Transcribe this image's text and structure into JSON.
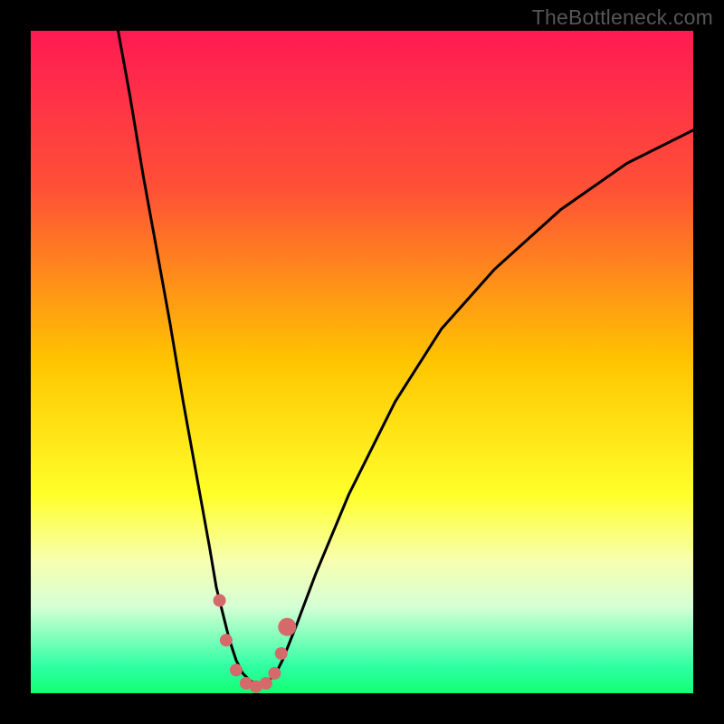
{
  "watermark": "TheBottleneck.com",
  "chart_data": {
    "type": "line",
    "title": "",
    "xlabel": "",
    "ylabel": "",
    "xlim": [
      0,
      100
    ],
    "ylim": [
      0,
      100
    ],
    "gradient_stops": [
      {
        "offset": 0,
        "color": "#ff1a53"
      },
      {
        "offset": 24,
        "color": "#ff5136"
      },
      {
        "offset": 50,
        "color": "#ffc500"
      },
      {
        "offset": 70,
        "color": "#ffff2a"
      },
      {
        "offset": 80,
        "color": "#f7ffb0"
      },
      {
        "offset": 87,
        "color": "#d5ffd5"
      },
      {
        "offset": 96,
        "color": "#2effa2"
      },
      {
        "offset": 100,
        "color": "#12ff74"
      }
    ],
    "series": [
      {
        "name": "bottleneck-curve",
        "x": [
          13,
          15,
          17,
          19,
          21,
          23,
          25,
          27,
          28,
          29,
          30,
          31,
          32,
          33,
          34.5,
          36,
          37,
          38,
          40,
          43,
          48,
          55,
          62,
          70,
          80,
          90,
          100
        ],
        "y": [
          101,
          90,
          78,
          67,
          56,
          44,
          33,
          22,
          16,
          12,
          8,
          5,
          3,
          2,
          1,
          2,
          3,
          5,
          10,
          18,
          30,
          44,
          55,
          64,
          73,
          80,
          85
        ]
      }
    ],
    "markers": {
      "name": "highlighted-points",
      "color": "#d46a6a",
      "radius_small": 7,
      "radius_large": 10,
      "points": [
        {
          "x": 28.5,
          "y": 14,
          "r": "small"
        },
        {
          "x": 29.5,
          "y": 8,
          "r": "small"
        },
        {
          "x": 31.0,
          "y": 3.5,
          "r": "small"
        },
        {
          "x": 32.5,
          "y": 1.5,
          "r": "small"
        },
        {
          "x": 34.0,
          "y": 1.0,
          "r": "small"
        },
        {
          "x": 35.5,
          "y": 1.5,
          "r": "small"
        },
        {
          "x": 36.8,
          "y": 3.0,
          "r": "small"
        },
        {
          "x": 37.8,
          "y": 6.0,
          "r": "small"
        },
        {
          "x": 38.7,
          "y": 10.0,
          "r": "large"
        }
      ]
    }
  }
}
